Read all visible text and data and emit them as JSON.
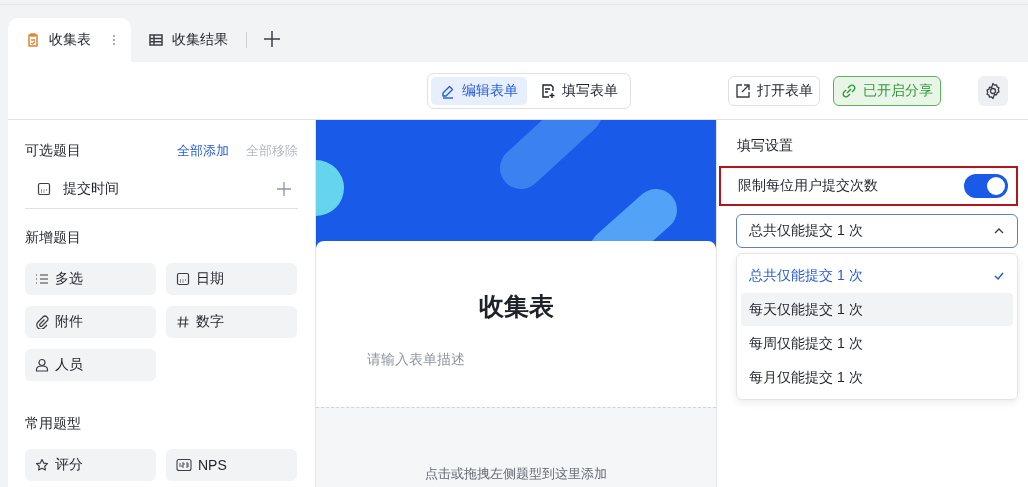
{
  "tabs": [
    {
      "label": "收集表",
      "selected": true,
      "kind": "form"
    },
    {
      "label": "收集结果",
      "selected": false,
      "kind": "table"
    }
  ],
  "toolbar": {
    "modes": [
      {
        "label": "编辑表单",
        "selected": true,
        "kind": "edit"
      },
      {
        "label": "填写表单",
        "selected": false,
        "kind": "fill"
      }
    ],
    "open_button": "打开表单",
    "share_button": {
      "label": "已开启分享",
      "on": true
    }
  },
  "left_panel": {
    "available": {
      "title": "可选题目",
      "add_all": "全部添加",
      "remove_all": {
        "label": "全部移除",
        "disabled": true
      },
      "items": [
        {
          "label": "提交时间"
        }
      ]
    },
    "sections": [
      {
        "title": "新增题目",
        "items": [
          {
            "label": "多选",
            "kind": "multi"
          },
          {
            "label": "日期",
            "kind": "date"
          },
          {
            "label": "附件",
            "kind": "attachment"
          },
          {
            "label": "数字",
            "kind": "number"
          },
          {
            "label": "人员",
            "kind": "person"
          }
        ]
      },
      {
        "title": "常用题型",
        "items": [
          {
            "label": "评分",
            "kind": "rating"
          },
          {
            "label": "NPS",
            "kind": "nps"
          }
        ]
      }
    ]
  },
  "form": {
    "title": "收集表",
    "description_placeholder": "请输入表单描述",
    "drop_hint": "点击或拖拽左侧题型到这里添加"
  },
  "settings": {
    "title": "填写设置",
    "limit": {
      "label": "限制每位用户提交次数",
      "on": true,
      "highlighted": true
    },
    "dropdown": {
      "value": "总共仅能提交 1 次",
      "expanded": true,
      "options": [
        {
          "label": "总共仅能提交 1 次",
          "selected": true,
          "hovered": false
        },
        {
          "label": "每天仅能提交 1 次",
          "selected": false,
          "hovered": true
        },
        {
          "label": "每周仅能提交 1 次",
          "selected": false,
          "hovered": false
        },
        {
          "label": "每月仅能提交 1 次",
          "selected": false,
          "hovered": false
        }
      ]
    }
  }
}
